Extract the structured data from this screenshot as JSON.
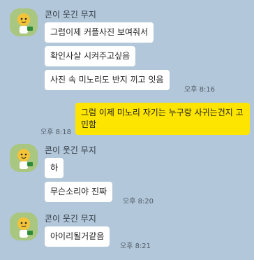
{
  "groups": [
    {
      "sender": "콘이 웃긴 무지",
      "messages": [
        "그럼이제 커플사진 보여줘서",
        "확인사살 시켜주고싶음",
        "사진 속 미노리도 반지 끼고 잇음"
      ],
      "time": "오후 8:16"
    },
    {
      "mine": true,
      "messages": [
        "그럼 이제 미노리 자기는 누구랑 사귀는건지 고민함"
      ],
      "time": "오후 8:18"
    },
    {
      "sender": "콘이 웃긴 무지",
      "messages": [
        "하",
        "무슨소리야 진짜"
      ],
      "time": "오후 8:20"
    },
    {
      "sender": "콘이 웃긴 무지",
      "messages": [
        "아이리될거같음"
      ],
      "time": "오후 8:21"
    }
  ],
  "colors": {
    "background": "#b2c7d9",
    "my_bubble": "#fee500",
    "their_bubble": "#ffffff",
    "avatar_bg": "#a9c780"
  }
}
